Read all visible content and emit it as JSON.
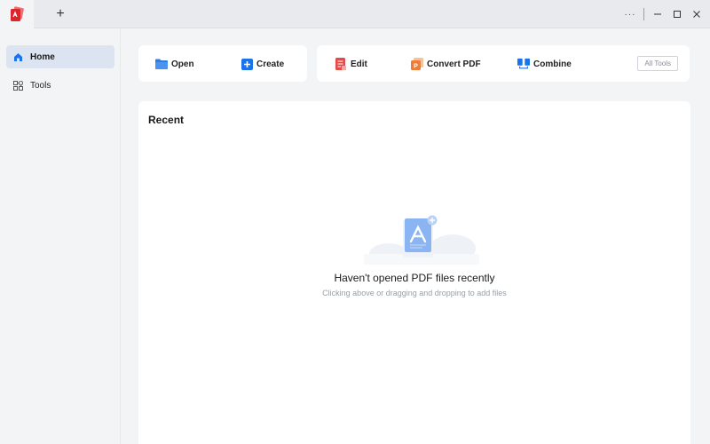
{
  "titlebar": {
    "new_tab_label": "+",
    "more_label": "···"
  },
  "sidebar": {
    "items": [
      {
        "label": "Home",
        "icon": "home-icon",
        "active": true
      },
      {
        "label": "Tools",
        "icon": "grid-icon",
        "active": false
      }
    ]
  },
  "quick_actions": {
    "open_label": "Open",
    "create_label": "Create"
  },
  "tools": {
    "edit_label": "Edit",
    "convert_label": "Convert PDF",
    "combine_label": "Combine",
    "all_tools_label": "All Tools"
  },
  "recent": {
    "title": "Recent",
    "empty_title": "Haven't opened PDF files recently",
    "empty_subtitle": "Clicking above or dragging and dropping to add files"
  },
  "colors": {
    "accent": "#1a73e8",
    "brand_red": "#e0312f",
    "sidebar_active": "#dbe4f0"
  }
}
